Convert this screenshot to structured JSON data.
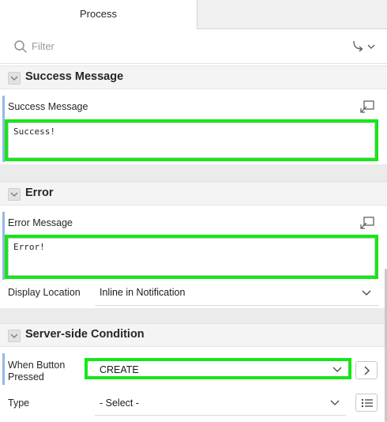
{
  "tabs": {
    "active_label": "Process"
  },
  "filter": {
    "placeholder": "Filter"
  },
  "sections": {
    "success": {
      "title": "Success Message",
      "field_label": "Success Message",
      "value": "Success!"
    },
    "error": {
      "title": "Error",
      "field_label": "Error Message",
      "value": "Error!",
      "display_location_label": "Display Location",
      "display_location_value": "Inline in Notification"
    },
    "condition": {
      "title": "Server-side Condition",
      "when_button_label": "When Button Pressed",
      "when_button_value": "CREATE",
      "type_label": "Type",
      "type_value": "- Select -"
    }
  },
  "colors": {
    "highlight": "#17e617",
    "required_bar": "#94b9e0",
    "section_bg": "#f4f4f4"
  },
  "icons": [
    "search-icon",
    "goto-arrow-icon",
    "chevron-down-icon",
    "collapse-toggle-icon",
    "expand-editor-icon",
    "chevron-right-icon",
    "list-icon"
  ]
}
